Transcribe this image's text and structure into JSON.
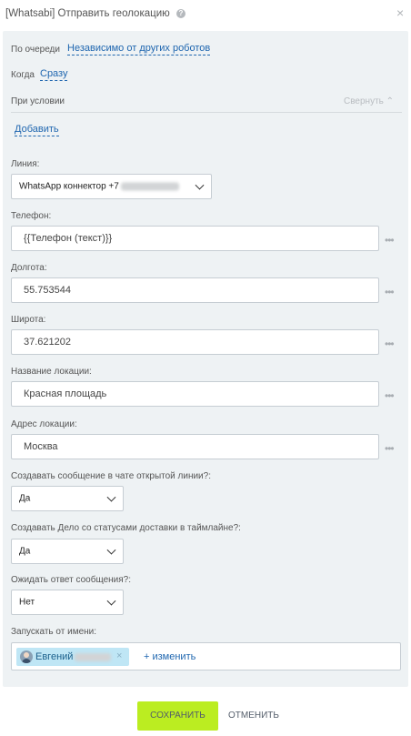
{
  "header": {
    "title": "[Whatsabi] Отправить геолокацию",
    "help_glyph": "?",
    "close_glyph": "×"
  },
  "queue": {
    "label": "По очереди",
    "value": "Независимо от других роботов"
  },
  "when": {
    "label": "Когда",
    "value": "Сразу"
  },
  "condition": {
    "label": "При условии",
    "collapse": "Свернуть",
    "add": "Добавить"
  },
  "line": {
    "label": "Линия:",
    "value": "WhatsApp коннектор +7"
  },
  "phone": {
    "label": "Телефон:",
    "value": "{{Телефон (текст)}}"
  },
  "longitude": {
    "label": "Долгота:",
    "value": "55.753544"
  },
  "latitude": {
    "label": "Широта:",
    "value": "37.621202"
  },
  "location_name": {
    "label": "Название локации:",
    "value": "Красная площадь"
  },
  "location_address": {
    "label": "Адрес локации:",
    "value": "Москва"
  },
  "create_message": {
    "label": "Создавать сообщение в чате открытой линии?:",
    "value": "Да"
  },
  "create_deal": {
    "label": "Создавать Дело со статусами доставки в таймлайне?:",
    "value": "Да"
  },
  "await_reply": {
    "label": "Ожидать ответ сообщения?:",
    "value": "Нет"
  },
  "run_as": {
    "label": "Запускать от имени:",
    "user": "Евгений",
    "change": "+ изменить",
    "remove_glyph": "×"
  },
  "more_glyph": "•••",
  "footer": {
    "save": "СОХРАНИТЬ",
    "cancel": "ОТМЕНИТЬ"
  },
  "colors": {
    "accent": "#2067b0",
    "save_button": "#bbed21",
    "panel": "#eef2f4"
  },
  "icons": [
    "help-icon",
    "close-icon",
    "chevron-up-icon",
    "chevron-down-icon",
    "more-icon",
    "avatar",
    "remove-icon"
  ]
}
